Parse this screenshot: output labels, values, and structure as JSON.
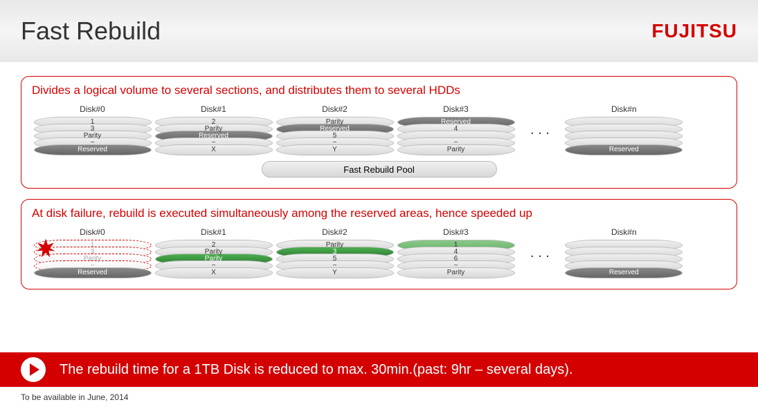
{
  "header": {
    "title": "Fast Rebuild",
    "logo": "FUJITSU"
  },
  "section1": {
    "title": "Divides a logical volume to several sections, and distributes them to several HDDs",
    "disks": [
      {
        "label": "Disk#0",
        "layers": [
          {
            "t": "1"
          },
          {
            "t": "3"
          },
          {
            "t": "Parity"
          },
          {
            "t": "~"
          },
          {
            "t": "Reserved",
            "c": "dark"
          }
        ]
      },
      {
        "label": "Disk#1",
        "layers": [
          {
            "t": "2"
          },
          {
            "t": "Parity"
          },
          {
            "t": "Reserved",
            "c": "dark"
          },
          {
            "t": "~"
          },
          {
            "t": "X"
          }
        ]
      },
      {
        "label": "Disk#2",
        "layers": [
          {
            "t": "Parity"
          },
          {
            "t": "Reserved",
            "c": "dark"
          },
          {
            "t": "5"
          },
          {
            "t": "~"
          },
          {
            "t": "Y"
          }
        ]
      },
      {
        "label": "Disk#3",
        "layers": [
          {
            "t": "Reserved",
            "c": "dark"
          },
          {
            "t": "4"
          },
          {
            "t": ""
          },
          {
            "t": "~"
          },
          {
            "t": "Parity"
          }
        ]
      }
    ],
    "dots": ". . .",
    "diskn": {
      "label": "Disk#n",
      "layers": [
        {
          "t": ""
        },
        {
          "t": ""
        },
        {
          "t": ""
        },
        {
          "t": ""
        },
        {
          "t": "Reserved",
          "c": "dark"
        }
      ]
    },
    "pool": "Fast Rebuild Pool"
  },
  "section2": {
    "title": "At disk failure, rebuild is executed simultaneously among the reserved areas, hence speeded up",
    "disks": [
      {
        "label": "Disk#0",
        "failed": true,
        "layers": [
          {
            "t": "1"
          },
          {
            "t": "3"
          },
          {
            "t": "Parity"
          },
          {
            "t": "~"
          },
          {
            "t": "Reserved",
            "c": "dark"
          }
        ]
      },
      {
        "label": "Disk#1",
        "layers": [
          {
            "t": "2"
          },
          {
            "t": "Parity"
          },
          {
            "t": "Parity",
            "c": "green"
          },
          {
            "t": "~"
          },
          {
            "t": "X"
          }
        ]
      },
      {
        "label": "Disk#2",
        "layers": [
          {
            "t": "Parity"
          },
          {
            "t": "3",
            "c": "green"
          },
          {
            "t": "5"
          },
          {
            "t": "~"
          },
          {
            "t": "Y"
          }
        ]
      },
      {
        "label": "Disk#3",
        "layers": [
          {
            "t": "1",
            "c": "greenlt"
          },
          {
            "t": "4"
          },
          {
            "t": "6"
          },
          {
            "t": "~"
          },
          {
            "t": "Parity"
          }
        ]
      }
    ],
    "dots": ". . .",
    "diskn": {
      "label": "Disk#n",
      "layers": [
        {
          "t": ""
        },
        {
          "t": ""
        },
        {
          "t": ""
        },
        {
          "t": ""
        },
        {
          "t": "Reserved",
          "c": "dark"
        }
      ]
    }
  },
  "footer": {
    "text": "The rebuild time for a 1TB Disk is reduced to max. 30min.(past: 9hr – several days)."
  },
  "footnote": "To be available in June, 2014"
}
